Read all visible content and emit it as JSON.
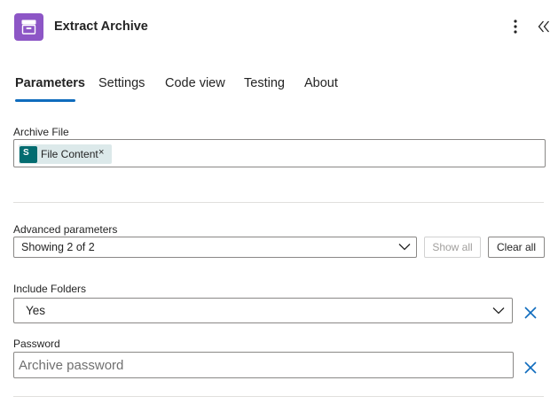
{
  "header": {
    "title": "Extract Archive",
    "icon": "archive-box-icon",
    "brand_color": "#8d56c6"
  },
  "tabs": [
    {
      "label": "Parameters",
      "active": true
    },
    {
      "label": "Settings",
      "active": false
    },
    {
      "label": "Code view",
      "active": false
    },
    {
      "label": "Testing",
      "active": false
    },
    {
      "label": "About",
      "active": false
    }
  ],
  "archive_file": {
    "label": "Archive File",
    "token": {
      "label": "File Content",
      "icon": "sharepoint-icon",
      "close_glyph": "×"
    }
  },
  "advanced": {
    "label": "Advanced parameters",
    "dropdown_value": "Showing 2 of 2",
    "show_all_label": "Show all",
    "clear_all_label": "Clear all"
  },
  "include_folders": {
    "label": "Include Folders",
    "value": "Yes"
  },
  "password": {
    "label": "Password",
    "placeholder": "Archive password",
    "value": ""
  },
  "colors": {
    "accent": "#0f6cbd",
    "sharepoint": "#036c70",
    "token_bg": "#dce9ea"
  }
}
